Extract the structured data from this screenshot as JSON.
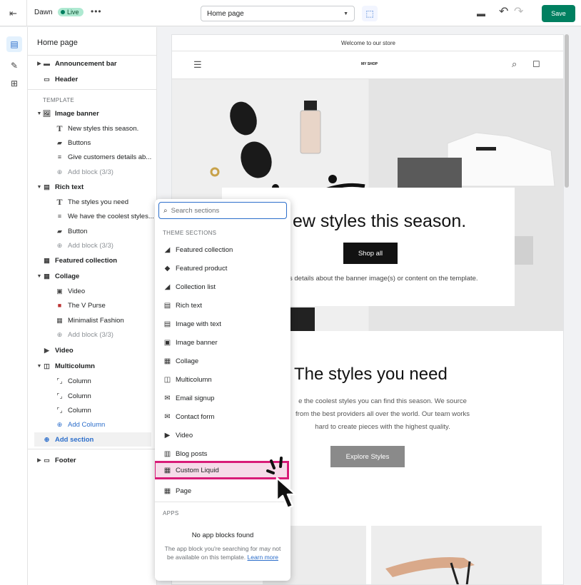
{
  "topbar": {
    "theme_name": "Dawn",
    "live_badge": "Live",
    "more": "•••",
    "page_select": "Home page",
    "save_label": "Save"
  },
  "sidebar": {
    "title": "Home page",
    "template_label": "TEMPLATE",
    "rows": [
      {
        "label": "Announcement bar"
      },
      {
        "label": "Header"
      },
      {
        "label": "Image banner"
      },
      {
        "label": "New styles this season."
      },
      {
        "label": "Buttons"
      },
      {
        "label": "Give customers details ab..."
      },
      {
        "label": "Add block (3/3)"
      },
      {
        "label": "Rich text"
      },
      {
        "label": "The styles you need"
      },
      {
        "label": "We have the coolest styles..."
      },
      {
        "label": "Button"
      },
      {
        "label": "Add block (3/3)"
      },
      {
        "label": "Featured collection"
      },
      {
        "label": "Collage"
      },
      {
        "label": "Video"
      },
      {
        "label": "The V Purse"
      },
      {
        "label": "Minimalist Fashion"
      },
      {
        "label": "Add block (3/3)"
      },
      {
        "label": "Video"
      },
      {
        "label": "Multicolumn"
      },
      {
        "label": "Column"
      },
      {
        "label": "Column"
      },
      {
        "label": "Column"
      },
      {
        "label": "Add Column"
      },
      {
        "label": "Add section"
      },
      {
        "label": "Footer"
      }
    ]
  },
  "preview": {
    "announcement": "Welcome to our store",
    "logo": "MY SHOP",
    "banner_heading": "ew styles this season.",
    "banner_button": "Shop all",
    "banner_text": "s details about the banner image(s) or content on the template.",
    "rich_heading": "The styles you need",
    "rich_text_lines": [
      "e the coolest styles you can find this season. We source",
      "from the best providers all over the world. Our team works",
      "hard to create pieces with the highest quality."
    ],
    "rich_button": "Explore Styles"
  },
  "popup": {
    "search_placeholder": "Search sections",
    "theme_sections_label": "THEME SECTIONS",
    "items": [
      {
        "label": "Featured collection",
        "icon": "collection-icon"
      },
      {
        "label": "Featured product",
        "icon": "tag-icon"
      },
      {
        "label": "Collection list",
        "icon": "collection-icon"
      },
      {
        "label": "Rich text",
        "icon": "text-block-icon"
      },
      {
        "label": "Image with text",
        "icon": "image-text-icon"
      },
      {
        "label": "Image banner",
        "icon": "image-icon"
      },
      {
        "label": "Collage",
        "icon": "collage-icon"
      },
      {
        "label": "Multicolumn",
        "icon": "columns-icon"
      },
      {
        "label": "Email signup",
        "icon": "envelope-icon"
      },
      {
        "label": "Contact form",
        "icon": "envelope-open-icon"
      },
      {
        "label": "Video",
        "icon": "play-icon"
      },
      {
        "label": "Blog posts",
        "icon": "blog-icon"
      },
      {
        "label": "Custom Liquid",
        "icon": "custom-liquid-icon"
      },
      {
        "label": "Page",
        "icon": "page-icon"
      }
    ],
    "apps_label": "APPS",
    "no_apps": "No app blocks found",
    "apps_desc": "The app block you're searching for may not be available on this template.",
    "learn_more": "Learn more"
  },
  "colors": {
    "accent_green": "#008060",
    "highlight_pink": "#d81b78",
    "link_blue": "#2c6ecb"
  }
}
